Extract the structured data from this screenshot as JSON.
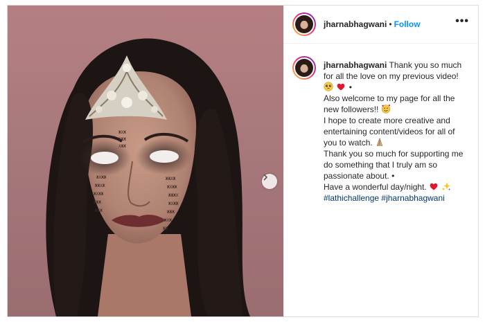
{
  "post": {
    "username": "jharnabhagwani",
    "separator": "•",
    "follow_label": "Follow",
    "more_label": "•••"
  },
  "caption": {
    "username": "jharnabhagwani",
    "line1": "Thank you so much",
    "line2": "for all the love on my previous video!",
    "line3_suffix": "•",
    "line4": "Also welcome to my page for all the",
    "line5": "new followers!!",
    "line6": "I hope to create more creative and",
    "line7": "entertaining content/videos for all of",
    "line8": "you to watch.",
    "line9": "Thank you so much for supporting me",
    "line10": "do something that I truly am so",
    "line11": "passionate about. •",
    "line12": "Have a wonderful day/night.",
    "hashtag1": "#lathichallenge",
    "hashtag2": "#jharnabhagwani"
  },
  "icons": {
    "next": "chevron-right-icon",
    "emoji_1": "pleading-face-emoji",
    "emoji_2": "red-heart-emoji",
    "emoji_3": "smiling-face-with-hearts-emoji",
    "emoji_4": "folded-hands-emoji",
    "emoji_5": "red-heart-emoji",
    "emoji_6": "sparkles-emoji"
  },
  "colors": {
    "follow": "#0095f6",
    "hashtag": "#00376b",
    "text": "#262626",
    "border": "#dbdbdb"
  }
}
